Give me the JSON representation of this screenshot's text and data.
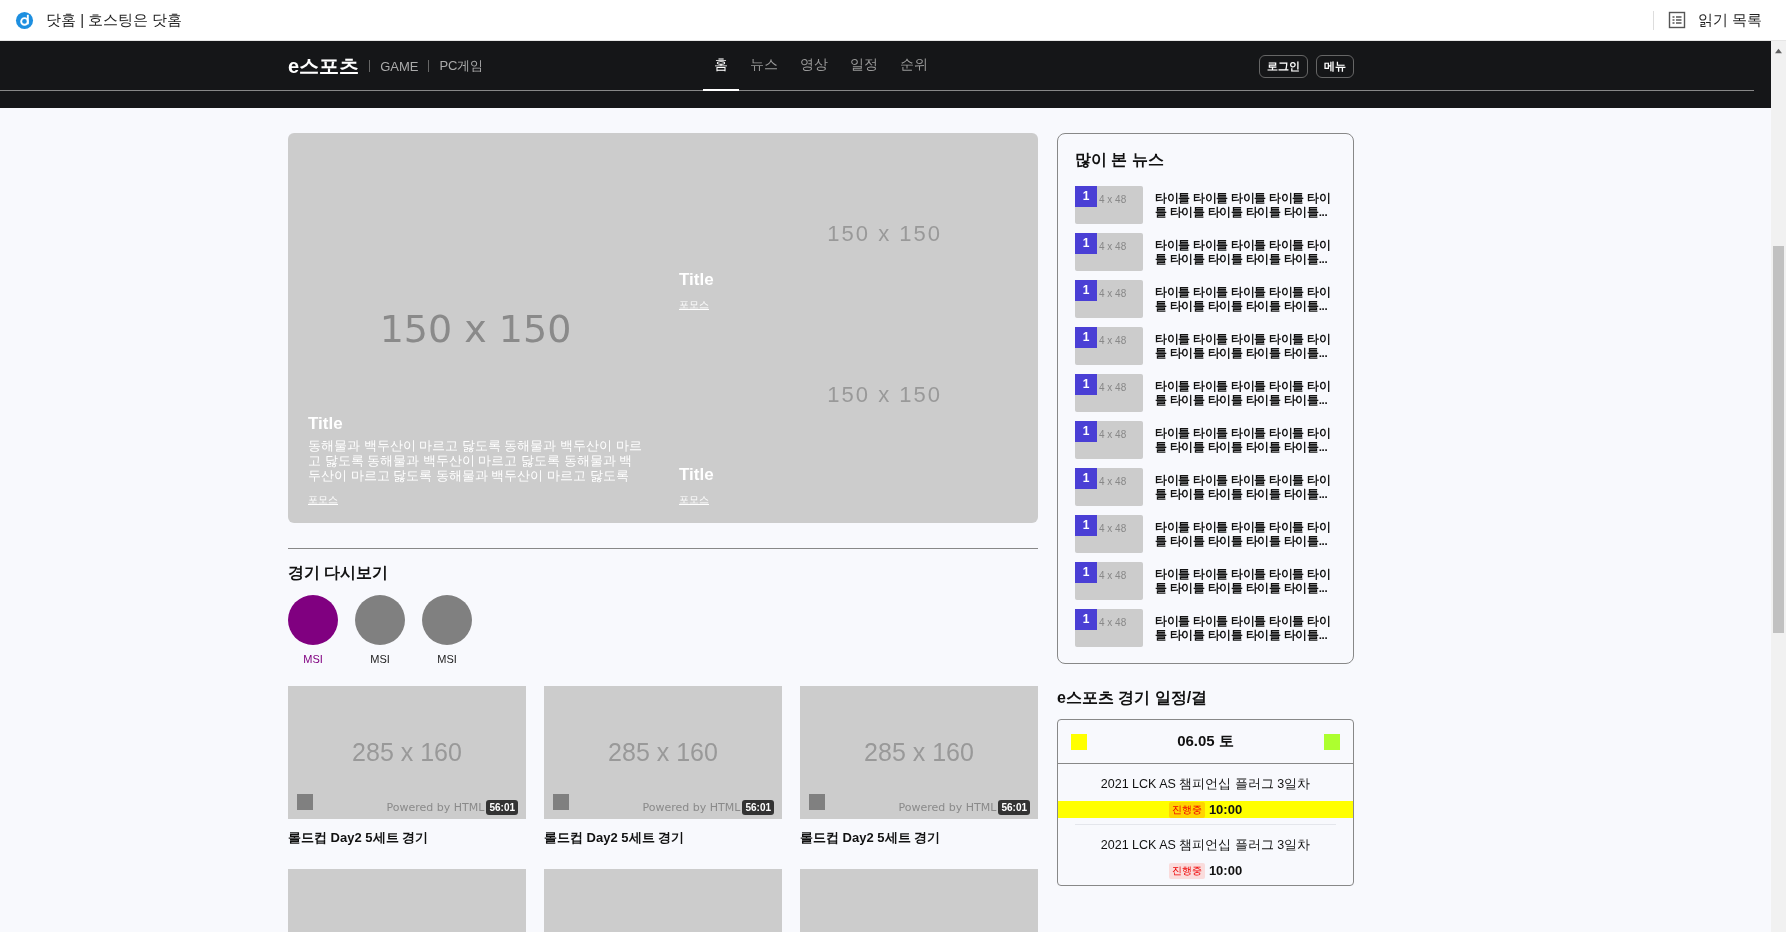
{
  "browser_bar": {
    "title": "닷홈 | 호스팅은 닷홈",
    "reading_list": "읽기 목록"
  },
  "header": {
    "logo": "e스포츠",
    "categories": [
      "GAME",
      "PC게임"
    ],
    "tabs": [
      {
        "label": "홈",
        "selected": true
      },
      {
        "label": "뉴스",
        "selected": false
      },
      {
        "label": "영상",
        "selected": false
      },
      {
        "label": "일정",
        "selected": false
      },
      {
        "label": "순위",
        "selected": false
      }
    ],
    "buttons": [
      "로그인",
      "메뉴"
    ]
  },
  "hero": {
    "main": {
      "image_label": "150 x 150",
      "title": "Title",
      "summary": "동해물과 백두산이 마르고 닳도록 동해물과 백두산이 마르고 닳도록 동해물과 백두산이 마르고 닳도록 동해물과 백두산이 마르고 닳도록 동해물과 백두산이 마르고 닳도록",
      "source": "포모스"
    },
    "side": [
      {
        "image_label": "150 x 150",
        "title": "Title",
        "source": "포모스"
      },
      {
        "image_label": "150 x 150",
        "title": "Title",
        "source": "포모스"
      }
    ]
  },
  "replay": {
    "title": "경기 다시보기",
    "leagues": [
      {
        "label": "MSI",
        "selected": true
      },
      {
        "label": "MSI",
        "selected": false
      },
      {
        "label": "MSI",
        "selected": false
      }
    ],
    "videos": [
      {
        "image_label": "285 x 160",
        "watermark": "Powered by HTML",
        "duration": "56:01",
        "title": "롤드컵 Day2 5세트 경기"
      },
      {
        "image_label": "285 x 160",
        "watermark": "Powered by HTML",
        "duration": "56:01",
        "title": "롤드컵 Day2 5세트 경기"
      },
      {
        "image_label": "285 x 160",
        "watermark": "Powered by HTML",
        "duration": "56:01",
        "title": "롤드컵 Day2 5세트 경기"
      }
    ]
  },
  "popular_news": {
    "title": "많이 본 뉴스",
    "items": [
      {
        "rank": "1",
        "image_label": "4 x 48",
        "title": "타이틀 타이틀 타이틀 타이틀 타이틀 타이틀 타이틀 타이틀 타이틀..."
      },
      {
        "rank": "1",
        "image_label": "4 x 48",
        "title": "타이틀 타이틀 타이틀 타이틀 타이틀 타이틀 타이틀 타이틀 타이틀..."
      },
      {
        "rank": "1",
        "image_label": "4 x 48",
        "title": "타이틀 타이틀 타이틀 타이틀 타이틀 타이틀 타이틀 타이틀 타이틀..."
      },
      {
        "rank": "1",
        "image_label": "4 x 48",
        "title": "타이틀 타이틀 타이틀 타이틀 타이틀 타이틀 타이틀 타이틀 타이틀..."
      },
      {
        "rank": "1",
        "image_label": "4 x 48",
        "title": "타이틀 타이틀 타이틀 타이틀 타이틀 타이틀 타이틀 타이틀 타이틀..."
      },
      {
        "rank": "1",
        "image_label": "4 x 48",
        "title": "타이틀 타이틀 타이틀 타이틀 타이틀 타이틀 타이틀 타이틀 타이틀..."
      },
      {
        "rank": "1",
        "image_label": "4 x 48",
        "title": "타이틀 타이틀 타이틀 타이틀 타이틀 타이틀 타이틀 타이틀 타이틀..."
      },
      {
        "rank": "1",
        "image_label": "4 x 48",
        "title": "타이틀 타이틀 타이틀 타이틀 타이틀 타이틀 타이틀 타이틀 타이틀..."
      },
      {
        "rank": "1",
        "image_label": "4 x 48",
        "title": "타이틀 타이틀 타이틀 타이틀 타이틀 타이틀 타이틀 타이틀 타이틀..."
      },
      {
        "rank": "1",
        "image_label": "4 x 48",
        "title": "타이틀 타이틀 타이틀 타이틀 타이틀 타이틀 타이틀 타이틀 타이틀..."
      }
    ]
  },
  "schedule": {
    "title": "e스포츠 경기 일정/결",
    "date": "06.05 토",
    "markers": [
      {
        "color": "#ffff00"
      },
      {
        "color": "#adff2f"
      }
    ],
    "matches": [
      {
        "title": "2021 LCK AS 챔피언십 플러그 3일차",
        "status": "진행중",
        "time": "10:00",
        "highlighted": true
      },
      {
        "title": "2021 LCK AS 챔피언십 플러그 3일차",
        "status": "진행중",
        "time": "10:00",
        "highlighted": false
      }
    ]
  }
}
